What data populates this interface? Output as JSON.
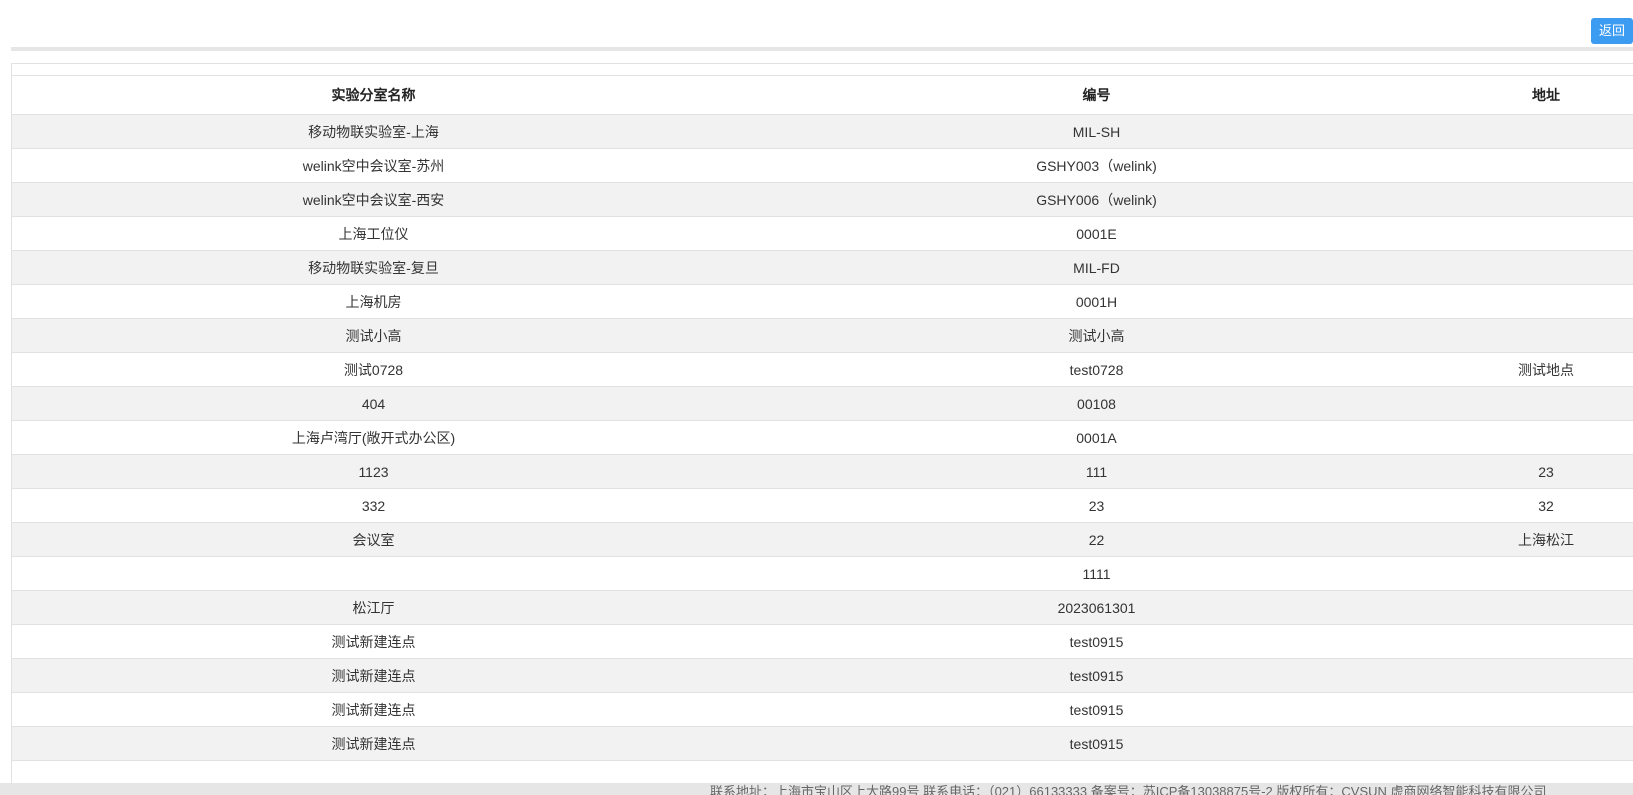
{
  "toolbar": {
    "back_label": "返回",
    "back_color": "#3c9cf2"
  },
  "table": {
    "columns": [
      "实验分室名称",
      "编号",
      "地址"
    ],
    "rows": [
      {
        "name": "移动物联实验室-上海",
        "code": "MIL-SH",
        "address": ""
      },
      {
        "name": "welink空中会议室-苏州",
        "code": "GSHY003（welink)",
        "address": ""
      },
      {
        "name": "welink空中会议室-西安",
        "code": "GSHY006（welink)",
        "address": ""
      },
      {
        "name": "上海工位仪",
        "code": "0001E",
        "address": ""
      },
      {
        "name": "移动物联实验室-复旦",
        "code": "MIL-FD",
        "address": ""
      },
      {
        "name": "上海机房",
        "code": "0001H",
        "address": ""
      },
      {
        "name": "测试小高",
        "code": "测试小高",
        "address": ""
      },
      {
        "name": "测试0728",
        "code": "test0728",
        "address": "测试地点"
      },
      {
        "name": "404",
        "code": "00108",
        "address": ""
      },
      {
        "name": "上海卢湾厅(敞开式办公区)",
        "code": "0001A",
        "address": ""
      },
      {
        "name": "1123",
        "code": "111",
        "address": "23"
      },
      {
        "name": "332",
        "code": "23",
        "address": "32"
      },
      {
        "name": "会议室",
        "code": "22",
        "address": "上海松江"
      },
      {
        "name": "",
        "code": "1111",
        "address": ""
      },
      {
        "name": "松江厅",
        "code": "2023061301",
        "address": ""
      },
      {
        "name": "测试新建连点",
        "code": "test0915",
        "address": ""
      },
      {
        "name": "测试新建连点",
        "code": "test0915",
        "address": ""
      },
      {
        "name": "测试新建连点",
        "code": "test0915",
        "address": ""
      },
      {
        "name": "测试新建连点",
        "code": "test0915",
        "address": ""
      }
    ]
  },
  "footer": {
    "text": "联系地址：上海市宝山区上大路99号  联系电话：（021）66133333  备案号：苏ICP备13038875号-2  版权所有：CVSUN 虚商网络智能科技有限公司"
  }
}
